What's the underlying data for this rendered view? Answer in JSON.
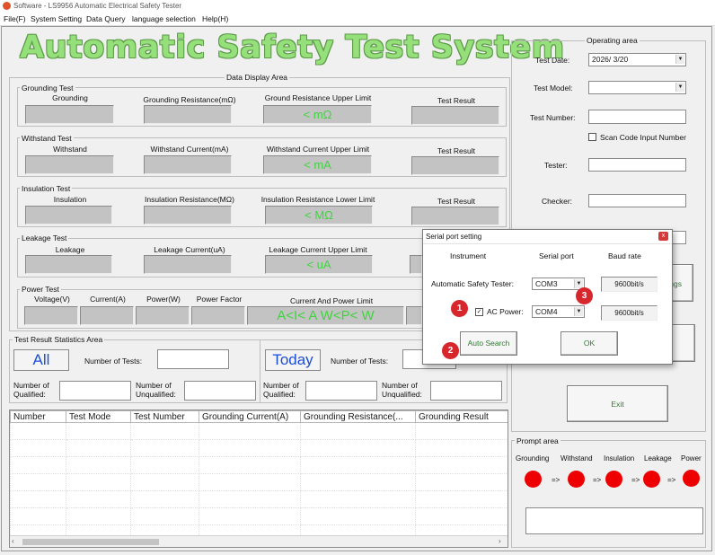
{
  "window": {
    "title": "Software - LS9956 Automatic Electrical Safety Tester"
  },
  "menu": [
    "File(F)",
    "System Setting",
    "Data Query",
    "language selection",
    "Help(H)"
  ],
  "header": {
    "title": "Automatic Safety Test System"
  },
  "data_display": {
    "title": "Data Display Area",
    "grounding": {
      "title": "Grounding Test",
      "name": "Grounding",
      "measure_label": "Grounding Resistance(mΩ)",
      "limit_label": "Ground Resistance Upper Limit",
      "limit_value": "< mΩ",
      "result_label": "Test Result"
    },
    "withstand": {
      "title": "Withstand Test",
      "name": "Withstand",
      "measure_label": "Withstand Current(mA)",
      "limit_label": "Withstand Current Upper Limit",
      "limit_value": "<  mA",
      "result_label": "Test Result"
    },
    "insulation": {
      "title": "Insulation Test",
      "name": "Insulation",
      "measure_label": "Insulation Resistance(MΩ)",
      "limit_label": "Insulation Resistance Lower Limit",
      "limit_value": "< MΩ",
      "result_label": "Test Result"
    },
    "leakage": {
      "title": "Leakage Test",
      "name": "Leakage",
      "measure_label": "Leakage Current(uA)",
      "limit_label": "Leakage Current Upper Limit",
      "limit_value": "< uA"
    },
    "power": {
      "title": "Power Test",
      "voltage_label": "Voltage(V)",
      "current_label": "Current(A)",
      "power_label": "Power(W)",
      "factor_label": "Power Factor",
      "limit_label": "Current And Power Limit",
      "limit_value": "A<I< A W<P< W"
    }
  },
  "statistics": {
    "title": "Test Result Statistics Area",
    "all": {
      "label": "All",
      "tests_label": "Number of Tests:",
      "qualified_label": "Number of Qualified:",
      "unqualified_label": "Number of Unqualified:"
    },
    "today": {
      "label": "Today",
      "tests_label": "Number of Tests:",
      "qualified_label": "Number of Qualified:",
      "unqualified_label": "Number of Unqualified:"
    }
  },
  "results_table": {
    "columns": [
      "Number",
      "Test Mode",
      "Test Number",
      "Grounding Current(A)",
      "Grounding Resistance(...",
      "Grounding Result"
    ]
  },
  "operating": {
    "title": "Operating area",
    "test_date_label": "Test Date:",
    "test_date_value": "2026/  3/20",
    "test_model_label": "Test Model:",
    "test_number_label": "Test Number:",
    "scan_code_label": "Scan Code Input Number",
    "tester_label": "Tester:",
    "checker_label": "Checker:",
    "settings_button_fragment": "ngs",
    "exit_button": "Exit"
  },
  "prompt": {
    "title": "Prompt area",
    "items": [
      "Grounding",
      "Withstand",
      "Insulation",
      "Leakage",
      "Power"
    ],
    "arrow": "=>"
  },
  "serial_dialog": {
    "title": "Serial port setting",
    "close_glyph": "x",
    "headers": {
      "instrument": "Instrument",
      "port": "Serial port",
      "baud": "Baud rate"
    },
    "row1": {
      "label": "Automatic Safety Tester:",
      "port": "COM3",
      "baud": "9600bit/s"
    },
    "row2": {
      "label": "AC Power:",
      "checked": true,
      "port": "COM4",
      "baud": "9600bit/s"
    },
    "auto_search": "Auto Search",
    "ok": "OK"
  },
  "annotations": {
    "m1": "1",
    "m2": "2",
    "m3": "3"
  },
  "colors": {
    "title_green": "#95e07a",
    "limit_green": "#3fd43f",
    "indicator_red": "#ee0000",
    "marker_red": "#d7262c",
    "stat_blue": "#1d4ed8"
  }
}
